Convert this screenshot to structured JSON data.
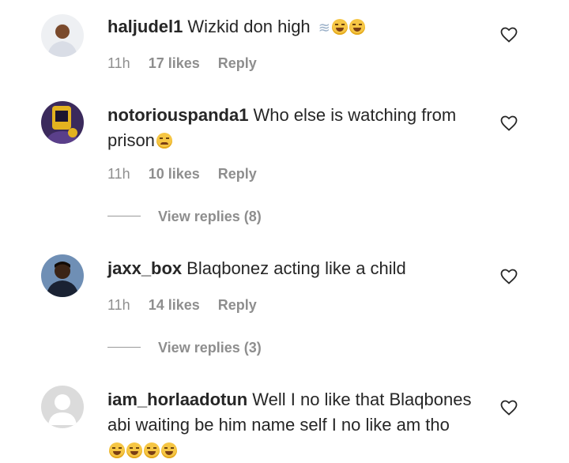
{
  "comments": [
    {
      "username": "haljudel1",
      "text": "Wizkid don high",
      "emojis": [
        "dash-icon",
        "grin-squint-icon",
        "grin-squint-icon"
      ],
      "time": "11h",
      "likes": "17 likes",
      "reply_label": "Reply",
      "avatar_colors": {
        "bg": "#eef0f3",
        "body": "#d9dde6",
        "face": "#7a4a2c"
      }
    },
    {
      "username": "notoriouspanda1",
      "text_line1": "Who else is watching from",
      "text_line2": "prison",
      "emojis": [
        "crying-icon"
      ],
      "time": "11h",
      "likes": "10 likes",
      "reply_label": "Reply",
      "view_replies": "View replies (8)",
      "avatar_colors": {
        "bg": "#3b2a5c",
        "accent": "#e3b21f",
        "dark": "#1c1430"
      }
    },
    {
      "username": "jaxx_box",
      "text": "Blaqbonez acting like a child",
      "time": "11h",
      "likes": "14 likes",
      "reply_label": "Reply",
      "view_replies": "View replies (3)",
      "avatar_colors": {
        "bg": "#6f8fb5",
        "body": "#1a2233",
        "face": "#3b2416"
      }
    },
    {
      "username": "iam_horlaadotun",
      "text_line1": "Well I no like that Blaqbones",
      "text_line2": "abi waiting be him name self I no like am tho",
      "emojis": [
        "grin-squint-icon",
        "grin-squint-icon",
        "grin-squint-icon",
        "grin-squint-icon"
      ],
      "avatar_colors": {
        "bg": "#dbdbdb",
        "fg": "#ffffff"
      }
    }
  ]
}
